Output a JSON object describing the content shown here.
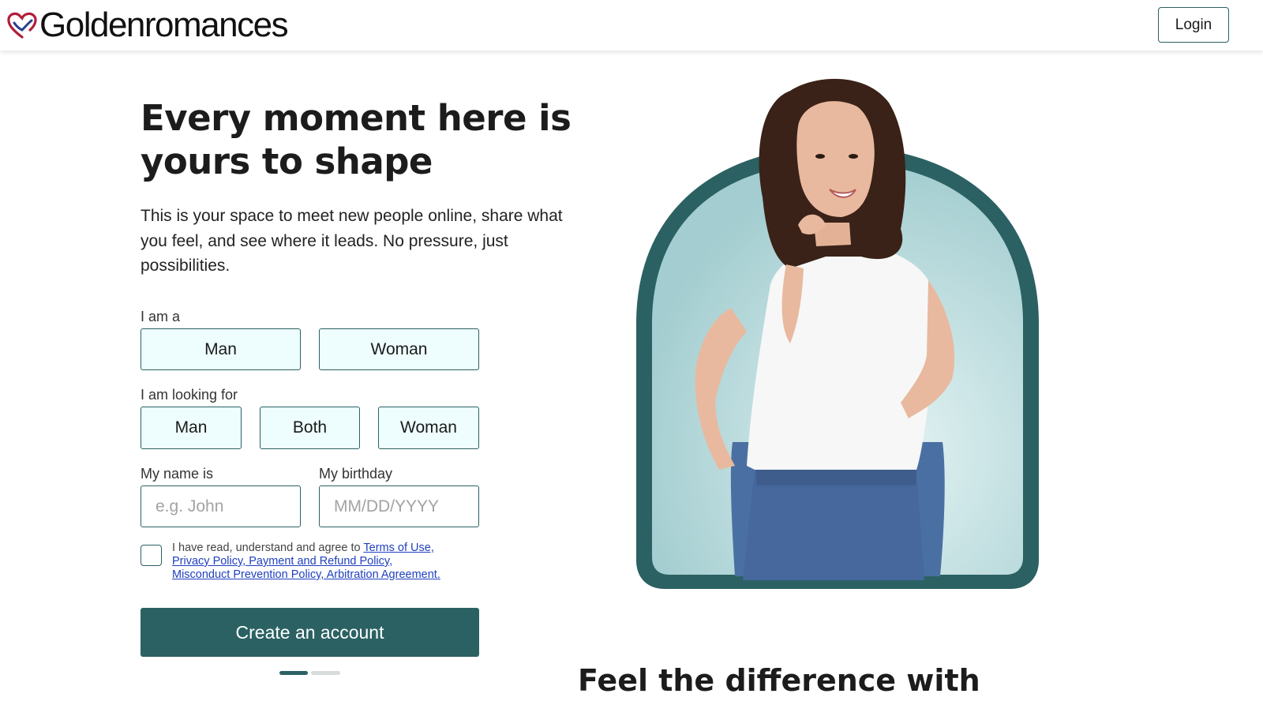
{
  "header": {
    "logo_text": "Goldenromances",
    "login_label": "Login"
  },
  "hero": {
    "headline": "Every moment here is yours to shape",
    "lede": "This is your space to meet new people online, share what you feel, and see where it leads. No pressure, just possibilities."
  },
  "form": {
    "i_am_label": "I am a",
    "i_am_options": [
      "Man",
      "Woman"
    ],
    "looking_for_label": "I am looking for",
    "looking_for_options": [
      "Man",
      "Both",
      "Woman"
    ],
    "name_label": "My name is",
    "name_placeholder": "e.g. John",
    "birthday_label": "My birthday",
    "birthday_placeholder": "MM/DD/YYYY",
    "terms_prefix": "I have read, understand and agree to",
    "terms_links": [
      "Terms of Use,",
      "Privacy Policy, Payment and Refund Policy,",
      "Misconduct Prevention Policy, Arbitration Agreement."
    ],
    "submit_label": "Create an account",
    "steps_total": 2,
    "step_current": 1
  },
  "section": {
    "title": "Feel the difference with"
  },
  "colors": {
    "brand": "#2b6163",
    "choice_bg": "#eefdfd",
    "link": "#1f3fbf",
    "arch_inner": "#a9d3d5"
  }
}
